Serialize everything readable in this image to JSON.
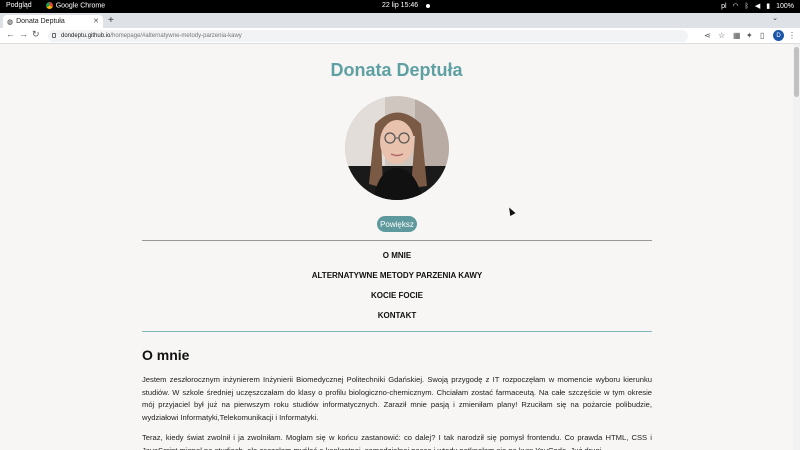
{
  "system": {
    "app_left": "Podgląd",
    "app_browser": "Google Chrome",
    "datetime": "22 lip 15:46",
    "lang": "pl",
    "battery": "100%"
  },
  "browser": {
    "tab_title": "Donata Deptuła",
    "url_host": "dondeptu.github.io",
    "url_path": "/homepage/#alternatywne-metody-parzenia-kawy",
    "profile_initial": "D"
  },
  "page": {
    "title": "Donata Deptuła",
    "zoom_button": "Powiększ",
    "nav": [
      "O MNIE",
      "ALTERNATYWNE METODY PARZENIA KAWY",
      "KOCIE FOCIE",
      "KONTAKT"
    ],
    "section_title": "O mnie",
    "paragraph1": "Jestem zeszłorocznym inżynierem Inżynierii Biomedycznej Politechniki Gdańskiej. Swoją przygodę z IT rozpoczęłam w momencie wyboru kierunku studiów. W szkole średniej uczęszczałam do klasy o profilu biologiczno-chemicznym. Chciałam zostać farmaceutą. Na całe szczęście w tym okresie mój przyjaciel był już na pierwszym roku studiów informatycznych. Zaraził mnie pasją i zmieniłam plany! Rzuciłam się na pożarcie polibudzie, wydziałowi Informatyki,Telekomunikacji i Informatyki.",
    "paragraph2": "Teraz, kiedy świat zwolnił i ja zwolniłam. Mogłam się w końcu zastanowić: co dalej? I tak narodził się pomysł frontendu. Co prawda HTML, CSS i JavaScript mignął na studiach, ale zaczęłam myśleć o konkretnej, samodzielnej pasce i wtedy natknęłam się na kurs YouCode. Już drugi"
  },
  "colors": {
    "accent": "#5fa0a3",
    "button": "#5e9a9d"
  }
}
